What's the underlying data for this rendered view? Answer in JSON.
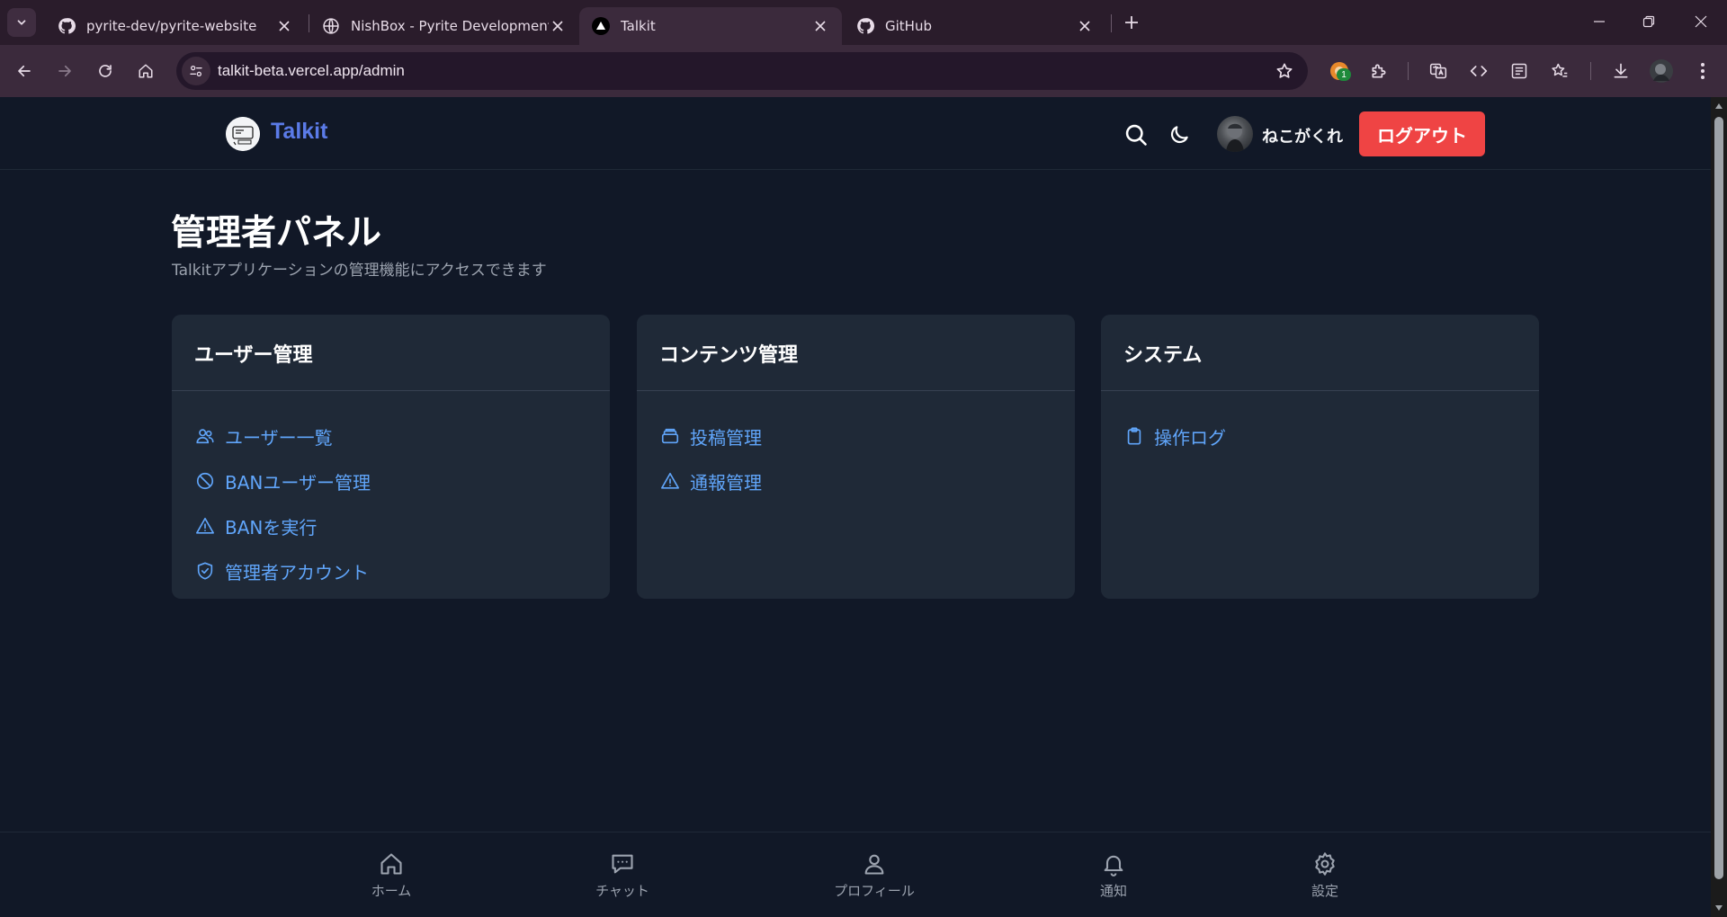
{
  "browser": {
    "tabs": [
      {
        "title": "pyrite-dev/pyrite-website",
        "favicon": "github-icon"
      },
      {
        "title": "NishBox - Pyrite Development T",
        "favicon": "globe-icon"
      },
      {
        "title": "Talkit",
        "favicon": "vercel-icon",
        "active": true
      },
      {
        "title": "GitHub",
        "favicon": "github-icon"
      }
    ],
    "url": "talkit-beta.vercel.app/admin",
    "extension_badge": "1"
  },
  "header": {
    "brand": "Talkit",
    "username": "ねこがくれ",
    "logout_label": "ログアウト"
  },
  "main": {
    "title": "管理者パネル",
    "subtitle": "Talkitアプリケーションの管理機能にアクセスできます",
    "cards": [
      {
        "title": "ユーザー管理",
        "links": [
          {
            "label": "ユーザー一覧",
            "icon": "users-icon"
          },
          {
            "label": "BANユーザー管理",
            "icon": "ban-icon"
          },
          {
            "label": "BANを実行",
            "icon": "warning-icon"
          },
          {
            "label": "管理者アカウント",
            "icon": "shield-check-icon"
          }
        ]
      },
      {
        "title": "コンテンツ管理",
        "links": [
          {
            "label": "投稿管理",
            "icon": "inbox-stack-icon"
          },
          {
            "label": "通報管理",
            "icon": "warning-icon"
          }
        ]
      },
      {
        "title": "システム",
        "links": [
          {
            "label": "操作ログ",
            "icon": "clipboard-icon"
          }
        ]
      }
    ]
  },
  "bottom_nav": [
    {
      "label": "ホーム",
      "icon": "home-icon"
    },
    {
      "label": "チャット",
      "icon": "chat-icon"
    },
    {
      "label": "プロフィール",
      "icon": "user-icon"
    },
    {
      "label": "通知",
      "icon": "bell-icon"
    },
    {
      "label": "設定",
      "icon": "gear-icon"
    }
  ],
  "colors": {
    "background": "#111827",
    "card": "#1f2937",
    "link": "#60a5fa",
    "brand": "#5b7be8",
    "logout": "#ef4444"
  }
}
